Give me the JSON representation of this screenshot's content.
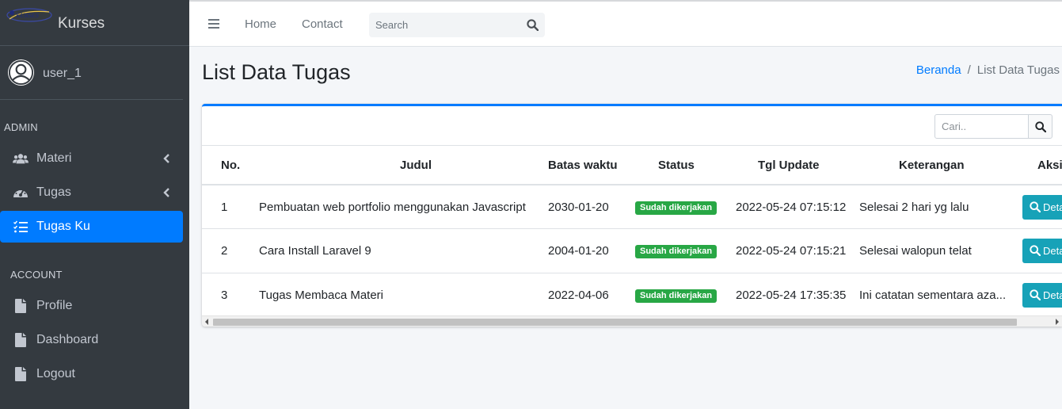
{
  "brand": {
    "name": "Kurses",
    "logo_text": "KURSES"
  },
  "user": {
    "name": "user_1"
  },
  "sidebar": {
    "admin_header": "ADMIN",
    "account_header": "ACCOUNT",
    "items": [
      {
        "label": "Materi",
        "icon": "users-icon"
      },
      {
        "label": "Tugas",
        "icon": "dashboard-gauge-icon"
      },
      {
        "label": "Tugas Ku",
        "icon": "task-list-icon",
        "active": true
      },
      {
        "label": "Profile",
        "icon": "file-icon"
      },
      {
        "label": "Dashboard",
        "icon": "file-icon"
      },
      {
        "label": "Logout",
        "icon": "file-icon"
      }
    ]
  },
  "navbar": {
    "home": "Home",
    "contact": "Contact",
    "search_placeholder": "Search"
  },
  "page": {
    "title": "List Data Tugas",
    "breadcrumb": [
      "Beranda",
      "List Data Tugas"
    ]
  },
  "card": {
    "search_placeholder": "Cari.."
  },
  "table": {
    "headers": [
      "No.",
      "Judul",
      "Batas waktu",
      "Status",
      "Tgl Update",
      "Keterangan",
      "Aksi"
    ],
    "rows": [
      {
        "no": "1",
        "judul": "Pembuatan web portfolio menggunakan Javascript",
        "batas": "2030-01-20",
        "status": "Sudah dikerjakan",
        "update": "2022-05-24 07:15:12",
        "ket": "Selesai 2 hari yg lalu",
        "aksi": "Detail"
      },
      {
        "no": "2",
        "judul": "Cara Install Laravel 9",
        "batas": "2004-01-20",
        "status": "Sudah dikerjakan",
        "update": "2022-05-24 07:15:21",
        "ket": "Selesai walopun telat",
        "aksi": "Detail"
      },
      {
        "no": "3",
        "judul": "Tugas Membaca Materi",
        "batas": "2022-04-06",
        "status": "Sudah dikerjakan",
        "update": "2022-05-24 17:35:35",
        "ket": "Ini catatan sementara aza...",
        "aksi": "Detail"
      }
    ]
  },
  "colors": {
    "primary": "#007bff",
    "success": "#28a745",
    "info": "#17a2b8",
    "sidebar": "#343a40"
  }
}
